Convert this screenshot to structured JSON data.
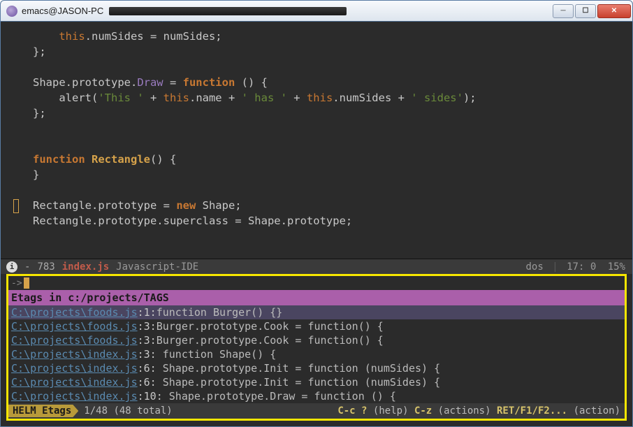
{
  "window": {
    "title": "emacs@JASON-PC"
  },
  "code_lines": [
    [
      [
        "    ",
        ""
      ],
      [
        "this",
        "this"
      ],
      [
        ".numSides = numSides;",
        "default"
      ]
    ],
    [
      [
        "};",
        "default"
      ]
    ],
    [
      [
        "",
        ""
      ]
    ],
    [
      [
        "Shape.prototype.",
        "default"
      ],
      [
        "Draw",
        "prop"
      ],
      [
        " = ",
        "default"
      ],
      [
        "function",
        "key"
      ],
      [
        " () {",
        "default"
      ]
    ],
    [
      [
        "    alert(",
        "default"
      ],
      [
        "'This '",
        "str"
      ],
      [
        " + ",
        "default"
      ],
      [
        "this",
        "this"
      ],
      [
        ".name + ",
        "default"
      ],
      [
        "' has '",
        "str"
      ],
      [
        " + ",
        "default"
      ],
      [
        "this",
        "this"
      ],
      [
        ".numSides + ",
        "default"
      ],
      [
        "' sides'",
        "str"
      ],
      [
        ");",
        "default"
      ]
    ],
    [
      [
        "};",
        "default"
      ]
    ],
    [
      [
        "",
        ""
      ]
    ],
    [
      [
        "",
        ""
      ]
    ],
    [
      [
        "function",
        "key"
      ],
      [
        " ",
        "default"
      ],
      [
        "Rectangle",
        "funcname"
      ],
      [
        "() {",
        "default"
      ]
    ],
    [
      [
        "}",
        "default"
      ]
    ],
    [
      [
        "",
        ""
      ]
    ],
    [
      [
        "Rectangle.prototype = ",
        "default"
      ],
      [
        "new",
        "key"
      ],
      [
        " Shape;",
        "default"
      ]
    ],
    [
      [
        "Rectangle.prototype.superclass = Shape.prototype;",
        "default"
      ]
    ]
  ],
  "modeline": {
    "modified": "-",
    "line_num": "783",
    "buffer": "index.js",
    "mode": "Javascript-IDE",
    "encoding": "dos",
    "pos": "17: 0",
    "percent": "15%"
  },
  "helm": {
    "header": "Etags in c:/projects/TAGS",
    "candidates": [
      {
        "file": "C:\\projects\\foods.js",
        "line": "1",
        "code": "function Burger() {}",
        "selected": true
      },
      {
        "file": "C:\\projects\\foods.js",
        "line": "3",
        "code": "Burger.prototype.Cook = function() {",
        "selected": false
      },
      {
        "file": "C:\\projects\\foods.js",
        "line": "3",
        "code": "Burger.prototype.Cook = function() {",
        "selected": false
      },
      {
        "file": "C:\\projects\\index.js",
        "line": "3",
        "code": "  function Shape() {",
        "selected": false
      },
      {
        "file": "C:\\projects\\index.js",
        "line": "6",
        "code": "   Shape.prototype.Init = function (numSides) {",
        "selected": false
      },
      {
        "file": "C:\\projects\\index.js",
        "line": "6",
        "code": "   Shape.prototype.Init = function (numSides) {",
        "selected": false
      },
      {
        "file": "C:\\projects\\index.js",
        "line": "10",
        "code": "   Shape.prototype.Draw = function () {",
        "selected": false
      }
    ],
    "footer": {
      "source": "HELM Etags",
      "count": "1/48 (48 total)",
      "help_key": "C-c ?",
      "help_label": "(help)",
      "actions_key": "C-z",
      "actions_label": "(actions)",
      "ret_key": "RET/F1/F2...",
      "ret_label": "(action)"
    }
  }
}
